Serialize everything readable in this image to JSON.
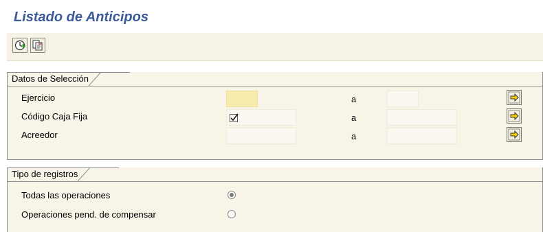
{
  "page": {
    "title": "Listado de Anticipos"
  },
  "toolbar": {
    "buttons": [
      {
        "icon": "execute-icon"
      },
      {
        "icon": "get-variant-icon"
      }
    ]
  },
  "seleccion": {
    "title": "Datos de Selección",
    "rows": [
      {
        "label": "Ejercicio",
        "from": "",
        "to_label": "a",
        "to": "",
        "required": true
      },
      {
        "label": "Código Caja Fija",
        "from": "",
        "to_label": "a",
        "to": "",
        "checked": true
      },
      {
        "label": "Acreedor",
        "from": "",
        "to_label": "a",
        "to": ""
      }
    ]
  },
  "tipo": {
    "title": "Tipo de registros",
    "options": [
      {
        "label": "Todas las operaciones",
        "selected": true
      },
      {
        "label": "Operaciones pend. de compensar",
        "selected": false
      }
    ]
  },
  "colors": {
    "title": "#3a5a9a",
    "panel": "#f8f4e8",
    "required_field": "#f7ecac",
    "arrow": "#f5d20a"
  }
}
